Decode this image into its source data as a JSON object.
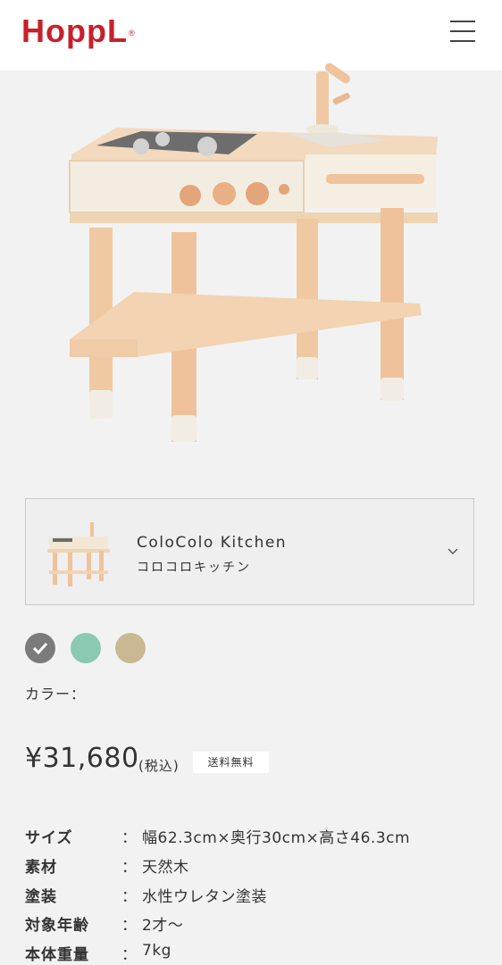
{
  "header": {
    "logo_text": "HoppL",
    "logo_mark": "®",
    "menu_icon": "hamburger-menu-icon"
  },
  "product_selector": {
    "name_en": "ColoColo Kitchen",
    "name_ja": "コロコロキッチン",
    "chevron_icon": "chevron-down-icon"
  },
  "colors": {
    "label": "カラー：",
    "swatches": [
      "#7b7b7b",
      "#8bc9b0",
      "#c9b892"
    ],
    "selected_index": 0
  },
  "price": {
    "amount": "¥31,680",
    "tax_note": "(税込)",
    "shipping_badge": "送料無料"
  },
  "specs": [
    {
      "key": "サイズ",
      "colon": "：",
      "value": "幅62.3cm×奥行30cm×高さ46.3cm"
    },
    {
      "key": "素材",
      "colon": "：",
      "value": "天然木"
    },
    {
      "key": "塗装",
      "colon": "：",
      "value": "水性ウレタン塗装"
    },
    {
      "key": "対象年齢",
      "colon": "：",
      "value": "2才〜"
    },
    {
      "key": "本体重量",
      "colon": "：",
      "value": "7kg"
    }
  ],
  "brand_color": "#c8202b"
}
